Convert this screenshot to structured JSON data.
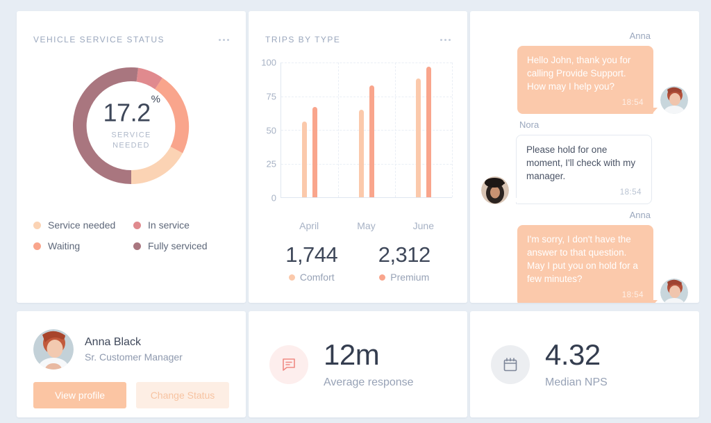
{
  "colors": {
    "page_bg": "#e7edf4",
    "card_bg": "#ffffff",
    "service_needed": "#fbd3b4",
    "waiting": "#f9a58c",
    "in_service": "#e08a8e",
    "fully_serviced": "#a9767f",
    "comfort": "#fbc9ab",
    "premium": "#f9a58c",
    "text_dark": "#3e4759",
    "text_muted": "#97a2b6"
  },
  "service_card": {
    "title": "Vehicle Service Status",
    "menu_icon": "more-options-icon",
    "center_value": "17.2",
    "center_unit": "%",
    "center_label_line1": "SERVICE",
    "center_label_line2": "NEEDED",
    "legend": [
      {
        "label": "Service needed",
        "color": "#fbd3b4"
      },
      {
        "label": "In service",
        "color": "#e08a8e"
      },
      {
        "label": "Waiting",
        "color": "#f9a58c"
      },
      {
        "label": "Fully serviced",
        "color": "#a9767f"
      }
    ]
  },
  "trips_card": {
    "title": "Trips by Type",
    "menu_icon": "more-options-icon",
    "totals": [
      {
        "value": "1,744",
        "label": "Comfort",
        "color": "#fbc9ab"
      },
      {
        "value": "2,312",
        "label": "Premium",
        "color": "#f9a58c"
      }
    ]
  },
  "chart_data": [
    {
      "type": "pie",
      "title": "Vehicle Service Status",
      "labels": [
        "Service needed",
        "Waiting",
        "In service",
        "Fully serviced"
      ],
      "values": [
        17.2,
        19.5,
        7.0,
        56.3
      ],
      "colors": [
        "#fbd3b4",
        "#f9a58c",
        "#e08a8e",
        "#a9767f"
      ],
      "donut": true,
      "center_text": "17.2%",
      "legend_position": "bottom"
    },
    {
      "type": "bar",
      "title": "Trips by Type",
      "categories": [
        "April",
        "May",
        "June"
      ],
      "series": [
        {
          "name": "Comfort",
          "values": [
            56,
            65,
            88
          ],
          "color": "#fbc9ab"
        },
        {
          "name": "Premium",
          "values": [
            67,
            83,
            97
          ],
          "color": "#f9a58c"
        }
      ],
      "xlabel": "",
      "ylabel": "",
      "ylim": [
        0,
        100
      ],
      "yticks": [
        0,
        25,
        50,
        75,
        100
      ],
      "grid": true,
      "legend_position": "bottom"
    }
  ],
  "chat": {
    "messages": [
      {
        "sender": "Anna",
        "side": "right",
        "text": "Hello John, thank you for calling Provide Support. How may I help you?",
        "time": "18:54",
        "avatar": "anna-avatar"
      },
      {
        "sender": "Nora",
        "side": "left",
        "text": "Please hold for one moment, I'll check with my manager.",
        "time": "18:54",
        "avatar": "nora-avatar"
      },
      {
        "sender": "Anna",
        "side": "right",
        "text": "I'm sorry, I don't have the answer to that question. May I put you on hold for a few minutes?",
        "time": "18:54",
        "avatar": "anna-avatar"
      }
    ]
  },
  "profile": {
    "avatar": "anna-black-avatar",
    "name": "Anna Black",
    "role": "Sr. Customer Manager",
    "primary_button": "View profile",
    "secondary_button": "Change Status"
  },
  "stats": [
    {
      "icon": "message-icon",
      "icon_bg": "#fdeeed",
      "icon_color": "#f08a84",
      "value": "12m",
      "label": "Average response"
    },
    {
      "icon": "calendar-icon",
      "icon_bg": "#eceef1",
      "icon_color": "#7c8598",
      "value": "4.32",
      "label": "Median NPS"
    }
  ]
}
